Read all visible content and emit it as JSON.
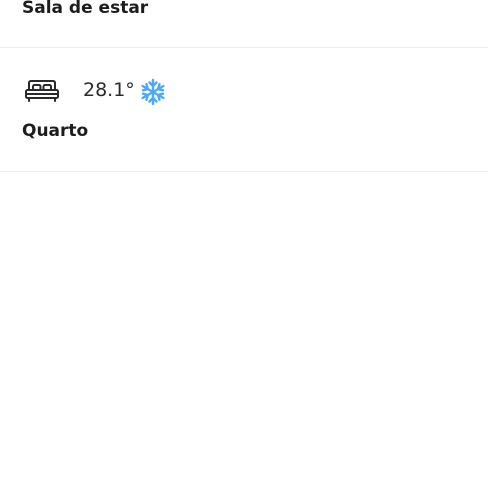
{
  "rooms": [
    {
      "name": "Sala de estar"
    },
    {
      "name": "Quarto",
      "temperature": "28.1°",
      "room_icon": "bed-icon",
      "mode_icon": "snowflake-icon",
      "mode_color": "#4aa8ff"
    }
  ]
}
